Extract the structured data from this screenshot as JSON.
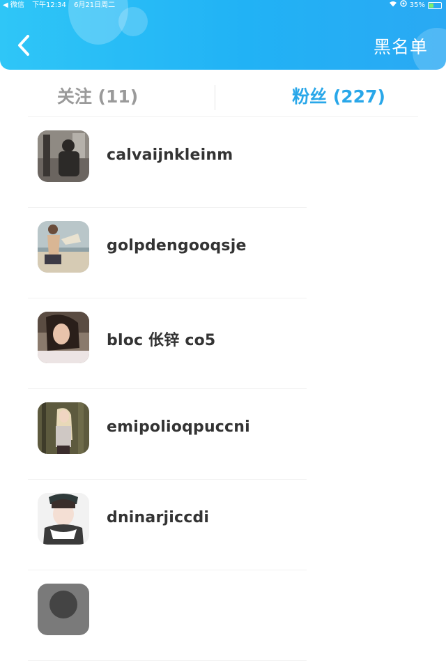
{
  "status_bar": {
    "carrier": "◀ 微信",
    "time": "下午12:34",
    "date": "6月21日周二",
    "battery": "35%"
  },
  "header": {
    "title": "黑名单",
    "back_icon": "chevron-left-icon"
  },
  "tabs": [
    {
      "label": "关注 (11)",
      "active": false
    },
    {
      "label": "粉丝 (227)",
      "active": true
    }
  ],
  "fans": [
    {
      "name": "calvaijnkleinm"
    },
    {
      "name": "golpdengooqsje"
    },
    {
      "name": "bloc 伥锌 co5"
    },
    {
      "name": "emipolioqpuccni"
    },
    {
      "name": "dninarjiccdi"
    }
  ],
  "colors": {
    "header_gradient_start": "#2fc6f7",
    "header_gradient_end": "#2aa9f3",
    "active_tab": "#29a7e9",
    "inactive_tab": "#9a9a9a"
  }
}
